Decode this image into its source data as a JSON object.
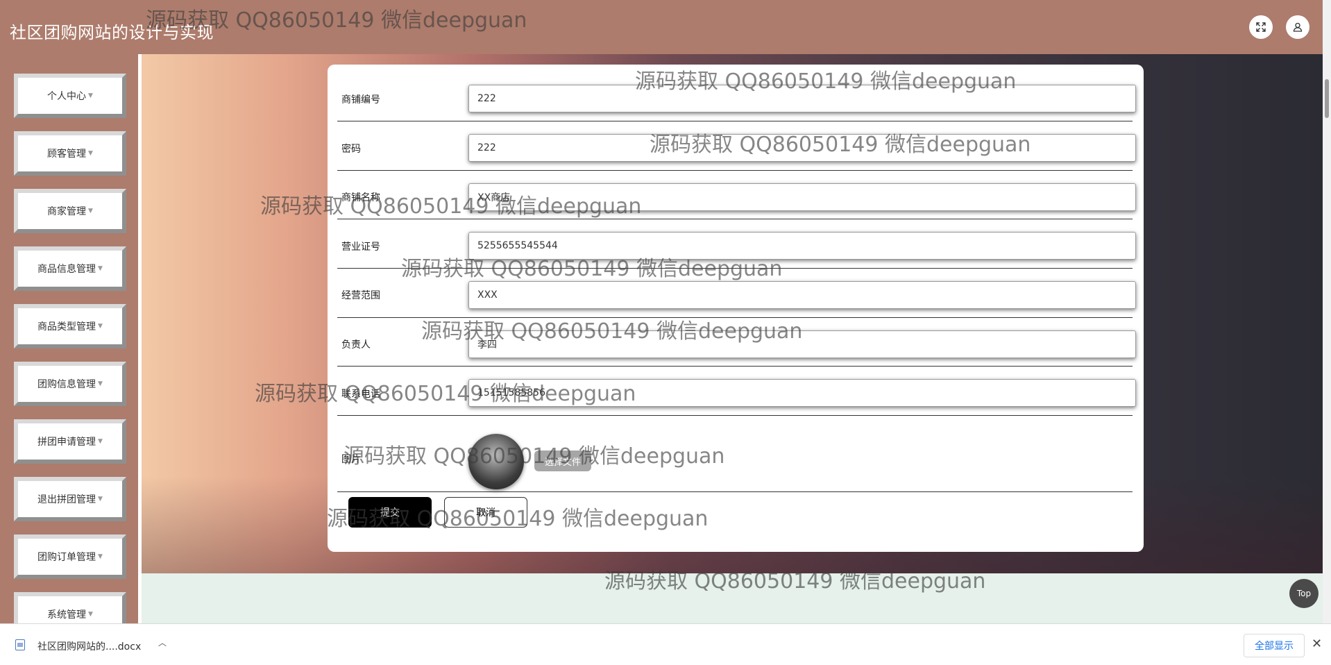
{
  "header": {
    "app_title": "社区团购网站的设计与实现",
    "fullscreen_icon": "fullscreen-icon",
    "user_icon": "user-icon"
  },
  "sidebar": {
    "items": [
      {
        "label": "个人中心"
      },
      {
        "label": "顾客管理"
      },
      {
        "label": "商家管理"
      },
      {
        "label": "商品信息管理"
      },
      {
        "label": "商品类型管理"
      },
      {
        "label": "团购信息管理"
      },
      {
        "label": "拼团申请管理"
      },
      {
        "label": "退出拼团管理"
      },
      {
        "label": "团购订单管理"
      },
      {
        "label": "系统管理"
      }
    ]
  },
  "form": {
    "fields": [
      {
        "label": "商铺编号",
        "value": "222"
      },
      {
        "label": "密码",
        "value": "222"
      },
      {
        "label": "商铺名称",
        "value": "XX商店"
      },
      {
        "label": "营业证号",
        "value": "5255655545544"
      },
      {
        "label": "经营范围",
        "value": "XXX"
      },
      {
        "label": "负责人",
        "value": "李四"
      },
      {
        "label": "联系电话",
        "value": "15151585856"
      }
    ],
    "photo_label": "图片",
    "choose_file_label": "选择文件",
    "submit_label": "提交",
    "cancel_label": "取消"
  },
  "top_button_label": "Top",
  "watermark_text": "源码获取 QQ86050149 微信deepguan",
  "download_bar": {
    "file_name": "社区团购网站的....docx",
    "show_all_label": "全部显示"
  }
}
